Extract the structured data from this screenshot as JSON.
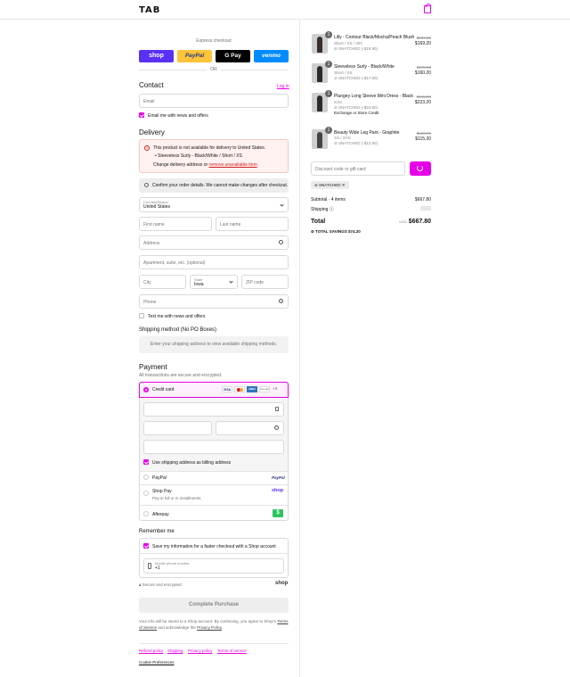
{
  "header": {
    "logo": "TAB",
    "cart_icon": "shopping-bag-icon"
  },
  "express": {
    "label": "Express checkout",
    "buttons": [
      {
        "label": "shop",
        "color": "#5a31f4"
      },
      {
        "label": "PayPal",
        "color": "#ffc439"
      },
      {
        "label": "G Pay",
        "color": "#000000"
      },
      {
        "label": "venmo",
        "color": "#008cff"
      }
    ],
    "or": "OR"
  },
  "contact": {
    "title": "Contact",
    "login": "Log in",
    "email_placeholder": "Email",
    "news_label": "Email me with news and offers"
  },
  "delivery": {
    "title": "Delivery",
    "error_title": "This product is not available for delivery to United States.",
    "error_item": "Sleeveless Surly - Black/White / Short / XS",
    "error_action_prefix": "Change delivery address or",
    "error_action_link": "remove unavailable item",
    "confirm_notice": "Confirm your order details. We cannot make changes after checkout.",
    "country_label": "Country/Region",
    "country_value": "United States",
    "first_name": "First name",
    "last_name": "Last name",
    "address": "Address",
    "apartment": "Apartment, suite, etc. (optional)",
    "city": "City",
    "state_label": "State",
    "state_value": "Iowa",
    "zip": "ZIP code",
    "phone": "Phone",
    "text_news": "Text me with news and offers"
  },
  "shipping": {
    "title": "Shipping method (No PO Boxes)",
    "placeholder": "Enter your shipping address to view available shipping methods."
  },
  "payment": {
    "title": "Payment",
    "subtitle": "All transactions are secure and encrypted.",
    "credit_card": "Credit card",
    "card_brands": [
      "VISA",
      "MC",
      "AMEX",
      "DISCOVER",
      "+4"
    ],
    "billing_label": "Use shipping address as billing address",
    "paypal": "PayPal",
    "shop_pay": "Shop Pay",
    "shop_pay_sub": "Pay in full or in installments",
    "afterpay": "Afterpay"
  },
  "remember": {
    "title": "Remember me",
    "save_label": "Save my information for a faster checkout with a Shop account",
    "mobile_label": "Mobile phone number",
    "mobile_value": "+1",
    "secure": "Secure and encrypted",
    "shop_logo": "shop"
  },
  "complete_button": "Complete Purchase",
  "legal": {
    "text": "Your info will be saved to a Shop account. By continuing, you agree to Shop's",
    "tos": "Terms of Service",
    "and": "and acknowledge the",
    "privacy": "Privacy Policy",
    "end": "."
  },
  "footer": {
    "links": [
      "Refund policy",
      "Shipping",
      "Privacy policy",
      "Terms of service"
    ],
    "cookie": "Cookie Preferences"
  },
  "cart": {
    "items": [
      {
        "qty": "1",
        "title": "Lilly - Contour Black/Mocha/Peach Blush",
        "variant": "Short / XS / 30C",
        "discount": "SNATCHED (-$18.90)",
        "old_price": "$189.00",
        "price": "$169.20"
      },
      {
        "qty": "1",
        "title": "Sleeveless Surly - Black/White",
        "variant": "Short / XS",
        "discount": "SNATCHED (-$17.80)",
        "old_price": "$178.00",
        "price": "$160.20"
      },
      {
        "qty": "1",
        "title": "Plungey Long Sleeve Mini Dress - Black",
        "variant": "XXS",
        "discount": "SNATCHED (-$24.80)",
        "old_price": "$248.00",
        "price": "$223.20",
        "note": "Exchange or Store Credit"
      },
      {
        "qty": "1",
        "title": "Beauty Wide Leg Pant - Graphite",
        "variant": "XS / XXS",
        "discount": "SNATCHED (-$12.80)",
        "old_price": "$128.00",
        "price": "$115.20"
      }
    ],
    "discount_placeholder": "Discount code or gift card",
    "applied_code": "SNATCHED",
    "subtotal_label": "Subtotal · 4 items",
    "subtotal_value": "$667.80",
    "shipping_label": "Shipping",
    "total_label": "Total",
    "total_currency": "USD",
    "total_value": "$667.80",
    "savings_label": "TOTAL SAVINGS",
    "savings_value": "$74.20"
  }
}
